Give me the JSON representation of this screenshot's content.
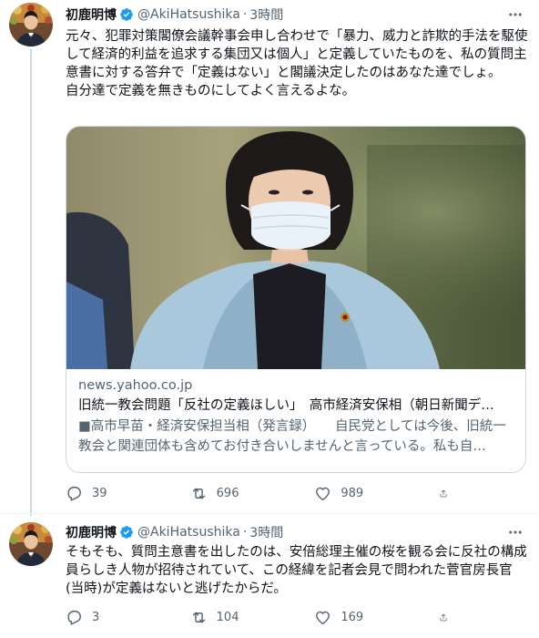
{
  "tweets": [
    {
      "author": {
        "name": "初鹿明博",
        "handle": "@AkiHatsushika",
        "time": "3時間"
      },
      "text": "元々、犯罪対策閣僚会議幹事会申し合わせで「暴力、威力と詐欺的手法を駆使して経済的利益を追求する集団又は個人」と定義していたものを、私の質問主意書に対する答弁で「定義はない」と閣議決定したのはあなた達でしょ。\n自分達で定義を無きものにしてよく言えるよな。",
      "card": {
        "domain": "news.yahoo.co.jp",
        "title": "旧統一教会問題「反社の定義ほしい」　高市経済安保相（朝日新聞デ…",
        "description": "■高市早苗・経済安保担当相（発言録）　　自民党としては今後、旧統一教会と関連団体も含めてお付き合いしませんと言っている。私も自…"
      },
      "stats": {
        "replies": "39",
        "retweets": "696",
        "likes": "989"
      }
    },
    {
      "author": {
        "name": "初鹿明博",
        "handle": "@AkiHatsushika",
        "time": "3時間"
      },
      "text": "そもそも、質問主意書を出したのは、安倍総理主催の桜を観る会に反社の構成員らしき人物が招待されていて、この経緯を記者会見で問われた菅官房長官(当時)が定義はないと逃げたからだ。",
      "stats": {
        "replies": "3",
        "retweets": "104",
        "likes": "169"
      }
    }
  ],
  "colors": {
    "text": "#0f1419",
    "secondary": "#536471",
    "verified": "#1d9bf0",
    "border": "#cfd9de"
  },
  "icons": [
    "verified-badge-icon",
    "more-icon",
    "reply-icon",
    "retweet-icon",
    "like-icon",
    "share-icon"
  ]
}
